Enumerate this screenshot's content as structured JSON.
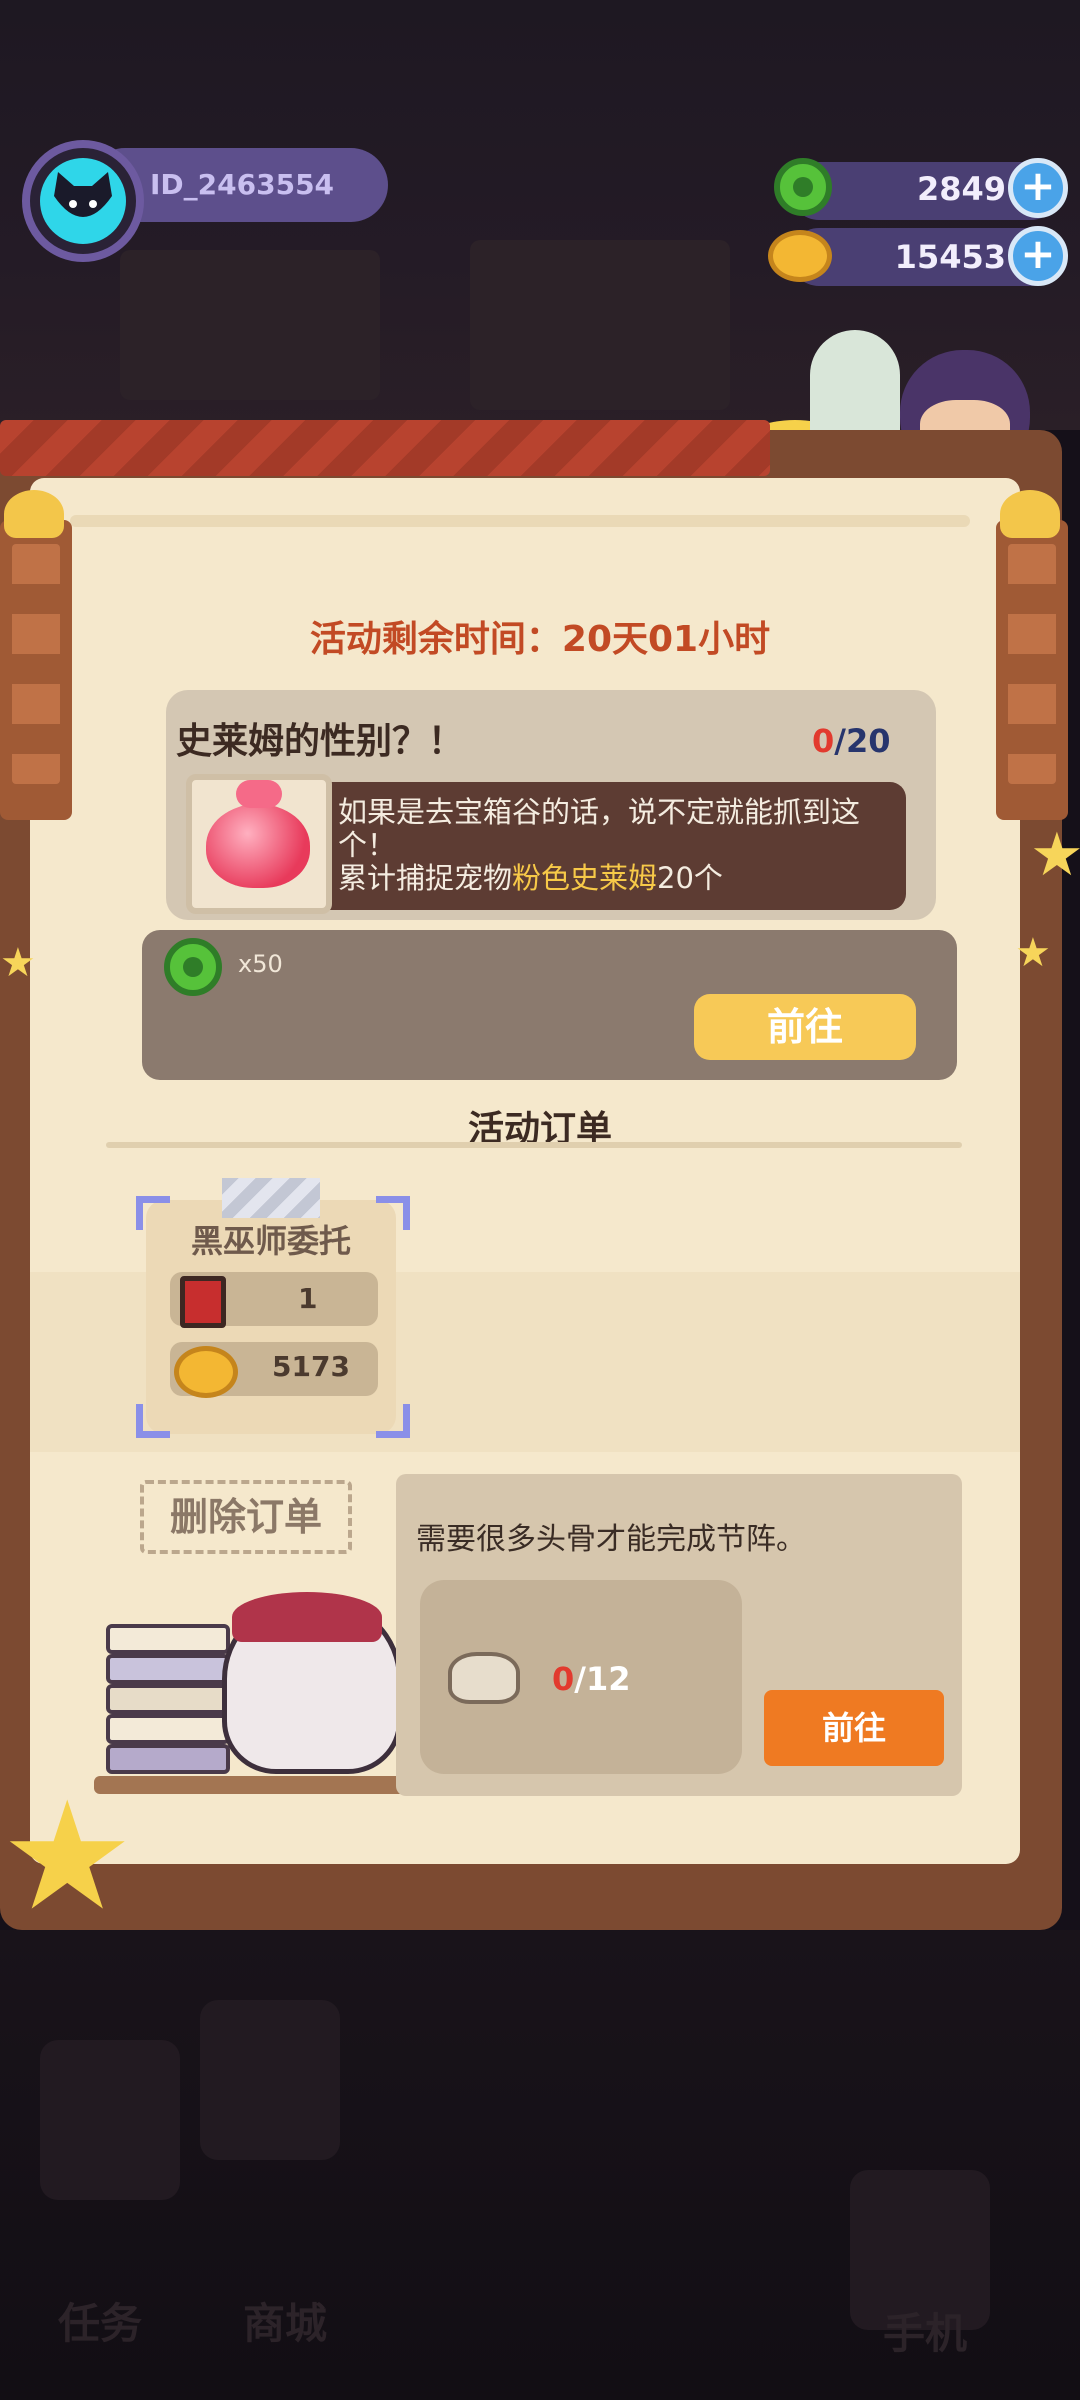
{
  "player": {
    "id": "ID_2463554"
  },
  "currencies": [
    {
      "name": "donut",
      "icon": "green-donut-icon",
      "amount": "2849"
    },
    {
      "name": "planet-coin",
      "icon": "planet-coin-icon",
      "amount": "15453"
    }
  ],
  "event": {
    "time_remaining": "活动剩余时间：20天01小时"
  },
  "quest": {
    "title": "史莱姆的性别？！",
    "progress_current": "0",
    "progress_total": "/20",
    "description_line1": "如果是去宝箱谷的话，说不定就能抓到这个！",
    "description_prefix": "累计捕捉宠物",
    "description_highlight": "粉色史莱姆",
    "description_suffix": "20个",
    "reward_count": "x50",
    "go_label": "前往"
  },
  "orders_section": {
    "title": "活动订单",
    "order": {
      "title": "黑巫师委托",
      "chest_count": "1",
      "coin_reward": "5173"
    },
    "delete_label": "删除订单"
  },
  "dialog": {
    "message": "需要很多头骨才能完成节阵。",
    "progress_current": "0",
    "progress_total": "/12",
    "go_label": "前往"
  },
  "bottom_nav": {
    "tasks": "任务",
    "shop": "商城",
    "phone": "手机"
  },
  "colors": {
    "timer": "#c24a24",
    "go_button": "#f7c957",
    "go_button_orange": "#ef7a22",
    "progress_current": "#e23a2e",
    "highlight": "#f7c948"
  }
}
